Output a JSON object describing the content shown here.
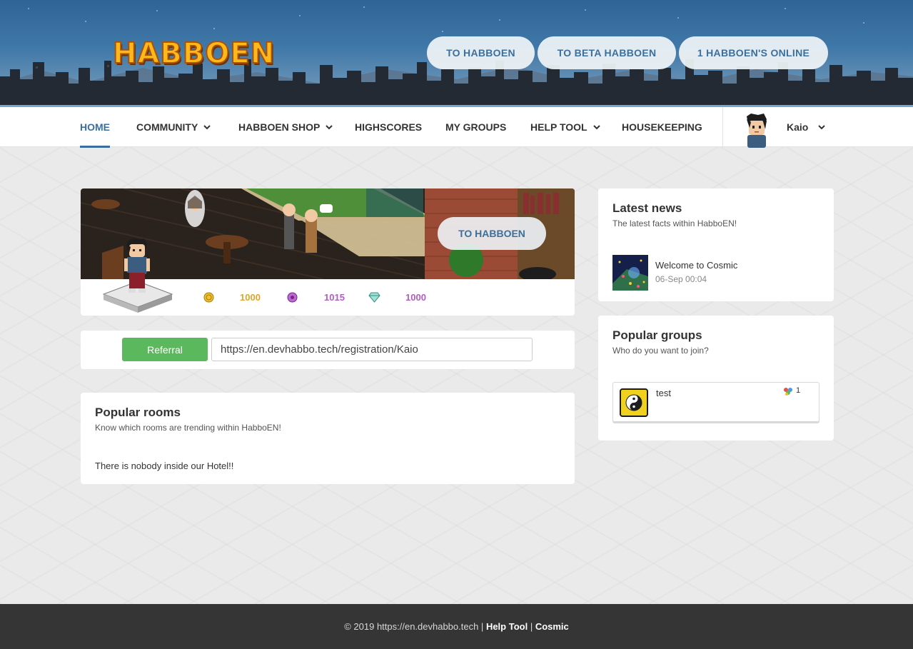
{
  "header": {
    "logo_text": "HABBOEN",
    "buttons": [
      "TO HABBOEN",
      "TO BETA HABBOEN",
      "1 HABBOEN'S ONLINE"
    ]
  },
  "nav": {
    "items": [
      {
        "label": "HOME",
        "active": true,
        "dropdown": false
      },
      {
        "label": "COMMUNITY",
        "active": false,
        "dropdown": true
      },
      {
        "label": "HABBOEN SHOP",
        "active": false,
        "dropdown": true
      },
      {
        "label": "HIGHSCORES",
        "active": false,
        "dropdown": false
      },
      {
        "label": "MY GROUPS",
        "active": false,
        "dropdown": false
      },
      {
        "label": "HELP TOOL",
        "active": false,
        "dropdown": true
      },
      {
        "label": "HOUSEKEEPING",
        "active": false,
        "dropdown": false
      }
    ],
    "user": {
      "name": "Kaio"
    }
  },
  "profile": {
    "banner_button": "TO HABBOEN",
    "currencies": [
      {
        "icon": "credits-coin-icon",
        "value": "1000",
        "color": "#e8a92e"
      },
      {
        "icon": "duckets-icon",
        "value": "1015",
        "color": "#b35bc4"
      },
      {
        "icon": "diamond-icon",
        "value": "1000",
        "color": "#b35bc4"
      }
    ]
  },
  "referral": {
    "button_label": "Referral",
    "url": "https://en.devhabbo.tech/registration/Kaio"
  },
  "popular_rooms": {
    "title": "Popular rooms",
    "subtitle": "Know which rooms are trending within HabboEN!",
    "empty_text": "There is nobody inside our Hotel!!"
  },
  "latest_news": {
    "title": "Latest news",
    "subtitle": "The latest facts within HabboEN!",
    "items": [
      {
        "title": "Welcome to Cosmic",
        "date": "06-Sep 00:04"
      }
    ]
  },
  "popular_groups": {
    "title": "Popular groups",
    "subtitle": "Who do you want to join?",
    "items": [
      {
        "name": "test",
        "members": "1"
      }
    ]
  },
  "footer": {
    "copyright": "© 2019 https://en.devhabbo.tech | ",
    "help_link": "Help Tool",
    "separator": " | ",
    "cosmic_link": "Cosmic"
  },
  "colors": {
    "accent": "#3a6ea0",
    "referral_green": "#5cb85c",
    "footer_bg": "#353535"
  }
}
